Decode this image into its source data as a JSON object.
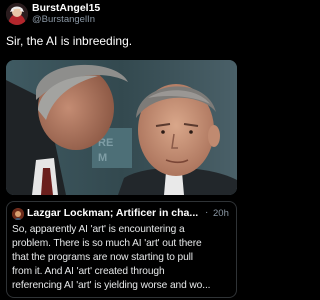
{
  "post": {
    "display_name": "BurstAngel15",
    "handle": "@BurstangelIn",
    "text": "Sir, the AI is inbreeding.",
    "avatar_icon": "character-avatar-icon",
    "media_image": "two-men-whispering-photo"
  },
  "quote": {
    "author": "Lazgar Lockman; Artificer in cha...",
    "separator": "·",
    "time": "20h",
    "avatar_icon": "author-avatar-icon",
    "lines": [
      "So, apparently AI 'art' is encountering a",
      "problem.  There is so much AI 'art' out there",
      "that the programs are now starting to pull",
      "from it.  And AI 'art' created through",
      "referencing AI 'art' is yielding worse and wo..."
    ]
  },
  "colors": {
    "background": "#000000",
    "primary_text": "#ffffff",
    "secondary_text": "#8b98a5",
    "border": "#2f3336"
  }
}
